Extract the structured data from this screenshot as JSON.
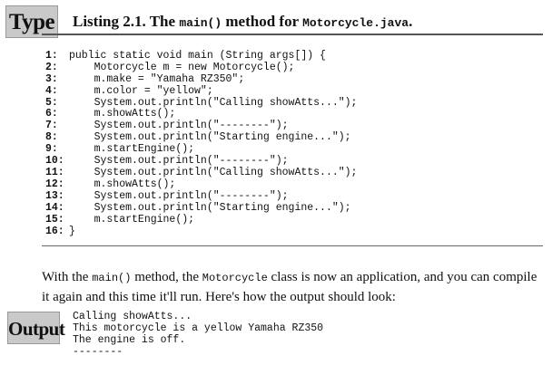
{
  "badges": {
    "type": "Type",
    "output": "Output"
  },
  "listing": {
    "prefix": "Listing 2.1. The ",
    "method": "main()",
    "middle": " method for ",
    "file": "Motorcycle.java",
    "suffix": "."
  },
  "code_lines": [
    {
      "num": "1:",
      "text": "public static void main (String args[]) {"
    },
    {
      "num": "2:",
      "text": "    Motorcycle m = new Motorcycle();"
    },
    {
      "num": "3:",
      "text": "    m.make = \"Yamaha RZ350\";"
    },
    {
      "num": "4:",
      "text": "    m.color = \"yellow\";"
    },
    {
      "num": "5:",
      "text": "    System.out.println(\"Calling showAtts...\");"
    },
    {
      "num": "6:",
      "text": "    m.showAtts();"
    },
    {
      "num": "7:",
      "text": "    System.out.println(\"--------\");"
    },
    {
      "num": "8:",
      "text": "    System.out.println(\"Starting engine...\");"
    },
    {
      "num": "9:",
      "text": "    m.startEngine();"
    },
    {
      "num": "10:",
      "text": "    System.out.println(\"--------\");"
    },
    {
      "num": "11:",
      "text": "    System.out.println(\"Calling showAtts...\");"
    },
    {
      "num": "12:",
      "text": "    m.showAtts();"
    },
    {
      "num": "13:",
      "text": "    System.out.println(\"--------\");"
    },
    {
      "num": "14:",
      "text": "    System.out.println(\"Starting engine...\");"
    },
    {
      "num": "15:",
      "text": "    m.startEngine();"
    },
    {
      "num": "16:",
      "text": "}"
    }
  ],
  "paragraph": {
    "p1": "With the ",
    "method": "main()",
    "p2": " method, the ",
    "cls": "Motorcycle",
    "p3": " class is now an application, and you can compile it again and this time it'll run. Here's how the output should look:"
  },
  "output_lines": [
    "Calling showAtts...",
    "This motorcycle is a yellow Yamaha RZ350",
    "The engine is off.",
    "--------"
  ]
}
